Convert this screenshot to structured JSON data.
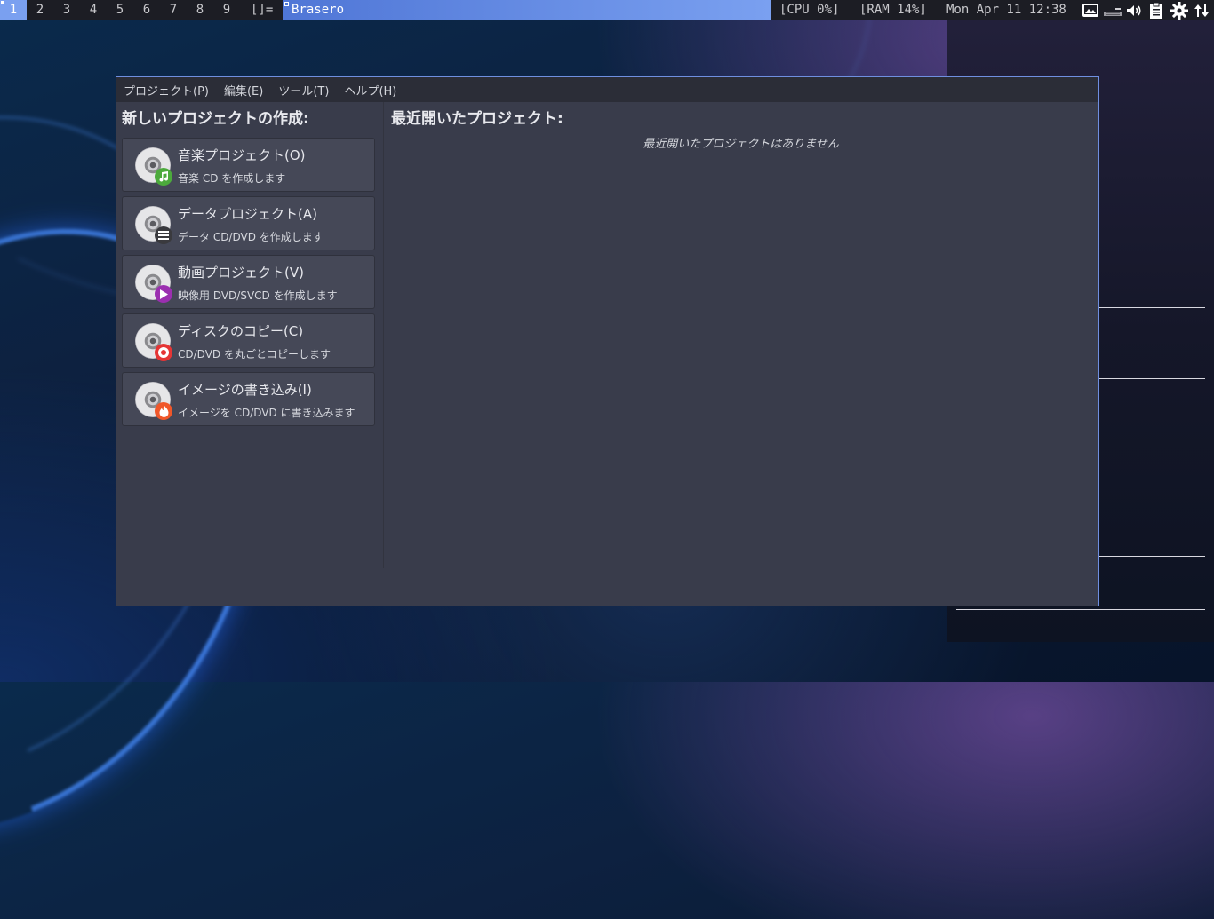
{
  "topbar": {
    "workspaces": [
      "1",
      "2",
      "3",
      "4",
      "5",
      "6",
      "7",
      "8",
      "9"
    ],
    "active_workspace": "1",
    "layout_symbol": "[]=",
    "window_title": "Brasero",
    "cpu": "[CPU 0%]",
    "ram": "[RAM 14%]",
    "datetime": "Mon Apr 11 12:38",
    "tray_icons": [
      "screenshot-icon",
      "keyboard-icon",
      "volume-icon",
      "clipboard-icon",
      "settings-icon",
      "network-transfer-icon"
    ]
  },
  "menubar": {
    "items": [
      "プロジェクト(P)",
      "編集(E)",
      "ツール(T)",
      "ヘルプ(H)"
    ]
  },
  "left": {
    "heading": "新しいプロジェクトの作成:",
    "projects": [
      {
        "title": "音楽プロジェクト(O)",
        "subtitle": "音楽 CD を作成します",
        "badge_icon": "music-note-icon",
        "badge_color": "#4caa3c"
      },
      {
        "title": "データプロジェクト(A)",
        "subtitle": "データ CD/DVD を作成します",
        "badge_icon": "list-icon",
        "badge_color": "#3a3a3e"
      },
      {
        "title": "動画プロジェクト(V)",
        "subtitle": "映像用 DVD/SVCD を作成します",
        "badge_icon": "play-icon",
        "badge_color": "#9b2fb0"
      },
      {
        "title": "ディスクのコピー(C)",
        "subtitle": "CD/DVD を丸ごとコピーします",
        "badge_icon": "disc-copy-icon",
        "badge_color": "#e53535"
      },
      {
        "title": "イメージの書き込み(I)",
        "subtitle": "イメージを CD/DVD に書き込みます",
        "badge_icon": "flame-icon",
        "badge_color": "#f0572a"
      }
    ]
  },
  "right": {
    "heading": "最近開いたプロジェクト:",
    "empty_message": "最近開いたプロジェクトはありません"
  },
  "colors": {
    "accent": "#7aa0f0",
    "window_bg": "#393c4b",
    "card_bg": "#454857"
  }
}
